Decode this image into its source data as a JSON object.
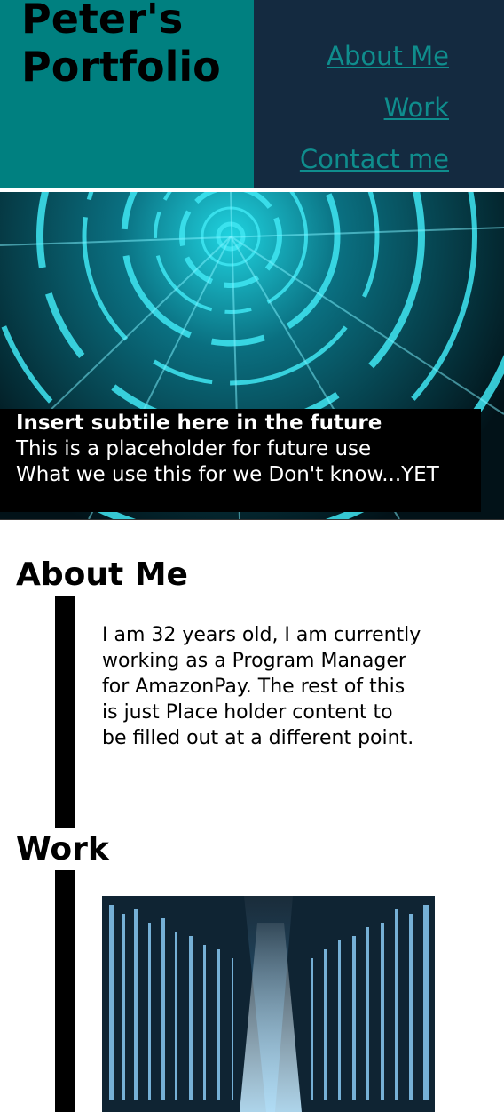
{
  "header": {
    "title": "Peter's Portfolio",
    "nav": [
      {
        "label": "About Me"
      },
      {
        "label": "Work"
      },
      {
        "label": "Contact me"
      }
    ]
  },
  "hero": {
    "subtitle": "Insert subtile here in the future",
    "line1": "This is a placeholder for future use",
    "line2": "What we use this for we Don't know...YET"
  },
  "about": {
    "title": "About Me",
    "text": "I am 32 years old, I am currently working as a Program Manager for AmazonPay. The rest of this is just Place holder content to be filled out at a different point."
  },
  "work": {
    "title": "Work"
  },
  "colors": {
    "brand_bg": "#008080",
    "header_bg": "#142a40",
    "nav_link": "#0f8d8d",
    "caption_bg": "#000000"
  }
}
